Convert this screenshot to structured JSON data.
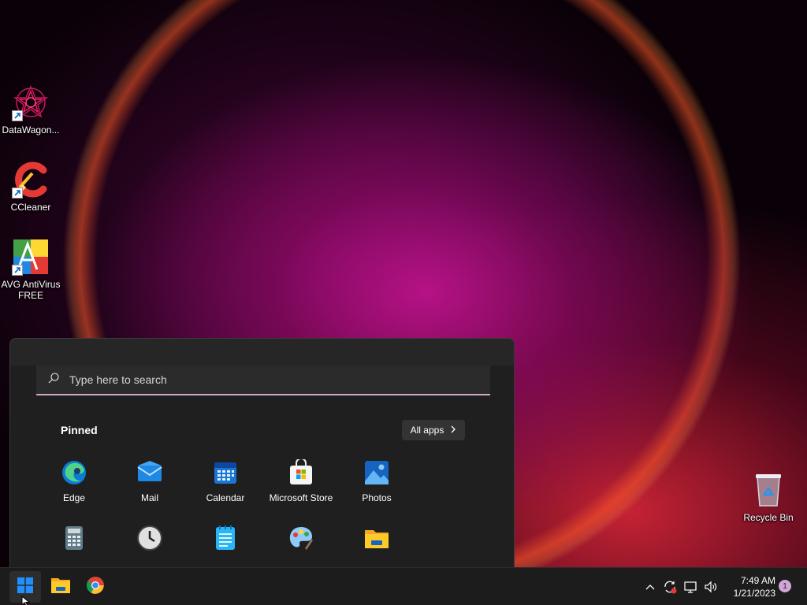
{
  "desktop": {
    "icons": [
      {
        "label": "DataWagon...",
        "icon": "datawagon-icon"
      },
      {
        "label": "CCleaner",
        "icon": "ccleaner-icon"
      },
      {
        "label": "AVG AntiVirus FREE",
        "icon": "avg-antivirus-icon"
      },
      {
        "label": "Recycle Bin",
        "icon": "recycle-bin-icon"
      }
    ]
  },
  "start_menu": {
    "search_placeholder": "Type here to search",
    "pinned_title": "Pinned",
    "all_apps_label": "All apps",
    "pinned_apps": [
      {
        "label": "Edge",
        "icon": "edge-icon"
      },
      {
        "label": "Mail",
        "icon": "mail-icon"
      },
      {
        "label": "Calendar",
        "icon": "calendar-icon"
      },
      {
        "label": "Microsoft Store",
        "icon": "microsoft-store-icon"
      },
      {
        "label": "Photos",
        "icon": "photos-icon"
      },
      {
        "label": "",
        "icon": "calculator-icon"
      },
      {
        "label": "",
        "icon": "clock-icon"
      },
      {
        "label": "",
        "icon": "notepad-icon"
      },
      {
        "label": "",
        "icon": "paint-icon"
      },
      {
        "label": "",
        "icon": "file-explorer-icon"
      }
    ]
  },
  "taskbar": {
    "apps": [
      {
        "name": "Start",
        "icon": "windows-start-icon"
      },
      {
        "name": "File Explorer",
        "icon": "file-explorer-icon"
      },
      {
        "name": "Google Chrome",
        "icon": "chrome-icon"
      }
    ],
    "tray": {
      "time": "7:49 AM",
      "date": "1/21/2023",
      "notification_count": "1"
    }
  },
  "colors": {
    "accent": "#0078d4",
    "search_underline": "#cfa8c8",
    "menu_bg": "#1f1f1f",
    "taskbar_bg": "#1c1c1c",
    "notif_badge": "#d3a6d8"
  }
}
